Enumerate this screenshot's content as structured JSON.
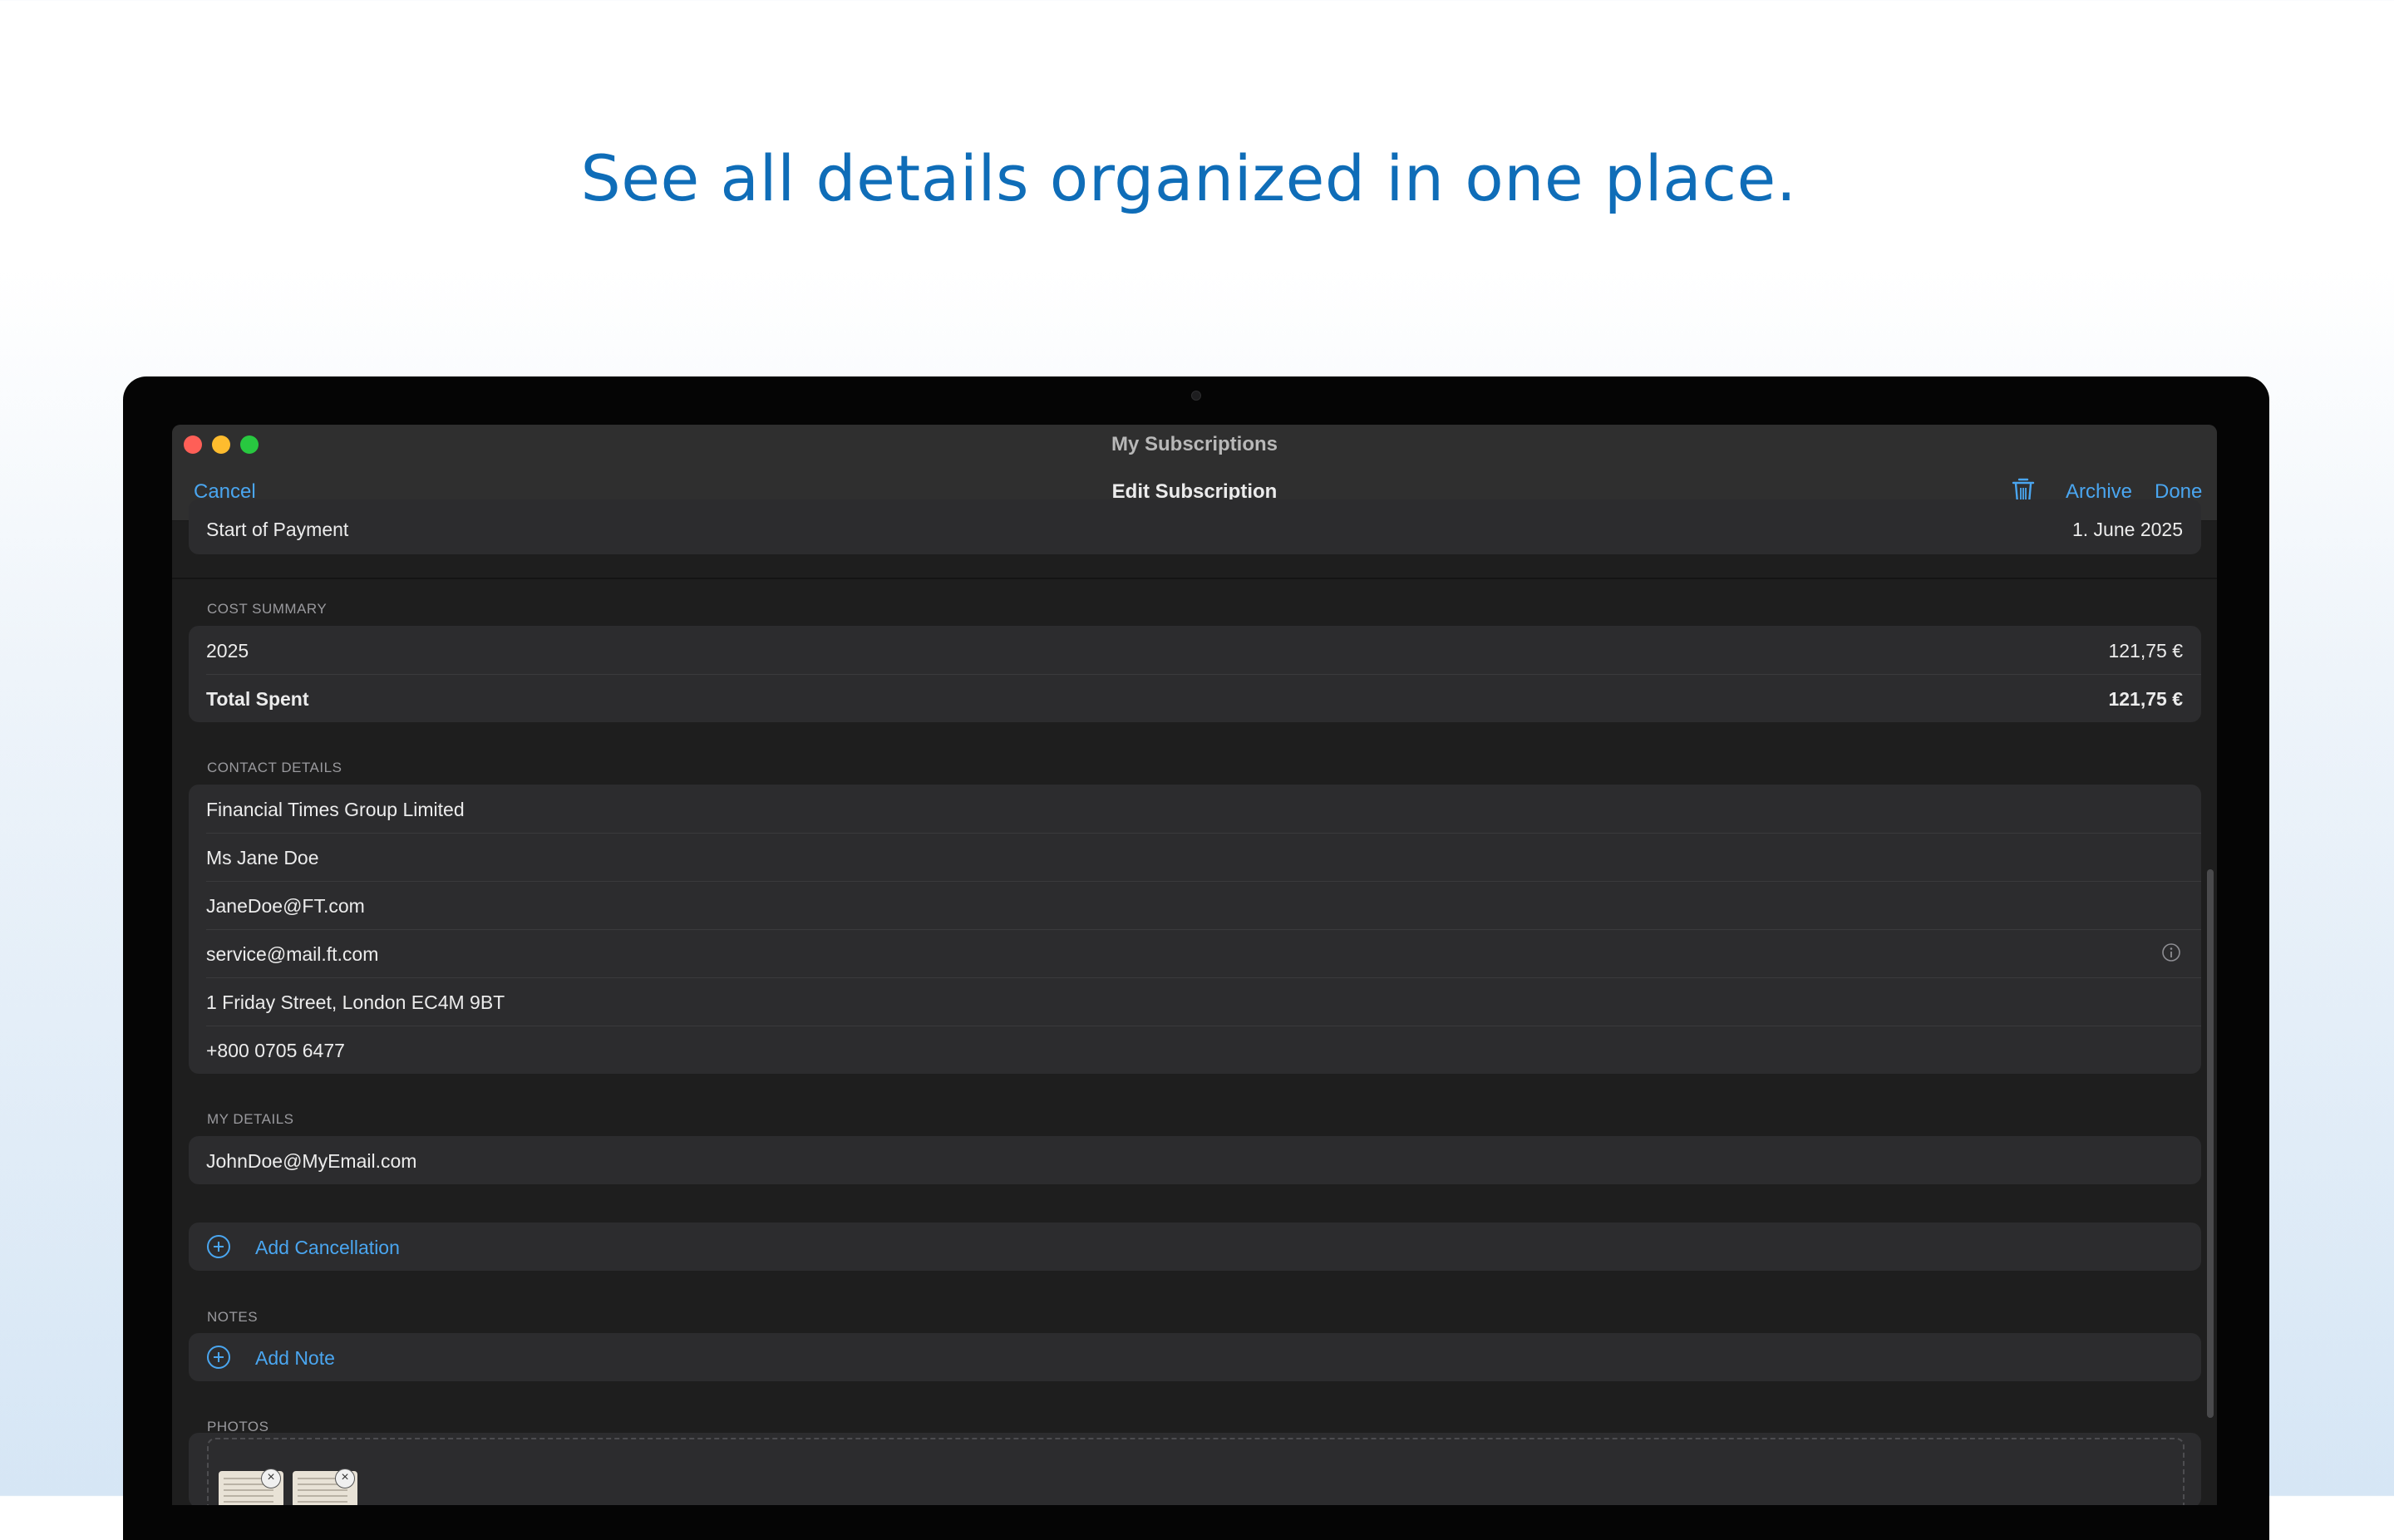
{
  "headline": "See all details organized in one place.",
  "window": {
    "title": "My Subscriptions"
  },
  "nav": {
    "cancel": "Cancel",
    "title": "Edit Subscription",
    "archive": "Archive",
    "done": "Done"
  },
  "start_row": {
    "label": "Start of Payment",
    "value": "1. June 2025"
  },
  "cost_summary": {
    "header": "COST SUMMARY",
    "rows": [
      {
        "label": "2025",
        "value": "121,75 €"
      },
      {
        "label": "Total Spent",
        "value": "121,75 €"
      }
    ]
  },
  "contact_details": {
    "header": "CONTACT DETAILS",
    "rows": [
      "Financial Times Group Limited",
      "Ms Jane Doe",
      "JaneDoe@FT.com",
      "service@mail.ft.com",
      "1 Friday Street, London EC4M 9BT",
      "+800 0705 6477"
    ]
  },
  "my_details": {
    "header": "MY DETAILS",
    "email": "JohnDoe@MyEmail.com"
  },
  "cancellation": {
    "add_label": "Add Cancellation"
  },
  "notes": {
    "header": "NOTES",
    "add_label": "Add Note"
  },
  "photos": {
    "header": "PHOTOS"
  },
  "icons": {
    "trash": "trash-icon",
    "info": "info-icon",
    "add": "plus-circle-icon",
    "remove": "close-circle-icon"
  },
  "colors": {
    "accent": "#4aa6f0",
    "headline": "#0f6db8",
    "window_bg": "#1e1e1e",
    "group_bg": "#2c2c2e"
  }
}
